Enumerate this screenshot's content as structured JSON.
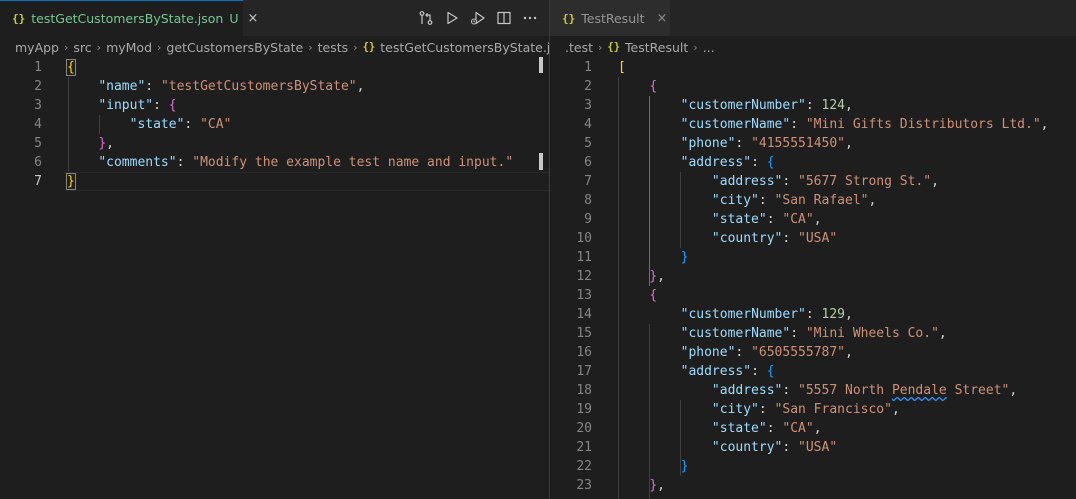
{
  "left": {
    "tab": {
      "icon": "{}",
      "label": "testGetCustomersByState.json",
      "badge": "U",
      "close": "×"
    },
    "actions": [
      {
        "name": "open-changes-icon",
        "title": "Open Changes"
      },
      {
        "name": "run-icon",
        "title": "Run"
      },
      {
        "name": "run-history-icon",
        "title": "Run All"
      },
      {
        "name": "split-editor-icon",
        "title": "Split Editor"
      },
      {
        "name": "more-actions-icon",
        "title": "More Actions"
      }
    ],
    "breadcrumb": [
      "myApp",
      "src",
      "myMod",
      "getCustomersByState",
      "tests",
      "testGetCustomersByState.json"
    ],
    "breadcrumb_file_icon": "{}",
    "active_line": 7,
    "lines": [
      {
        "n": "1",
        "t": [
          [
            "b1",
            "{"
          ]
        ]
      },
      {
        "n": "2",
        "t": [
          [
            "p",
            "    "
          ],
          [
            "k",
            "\"name\""
          ],
          [
            "p",
            ": "
          ],
          [
            "s",
            "\"testGetCustomersByState\""
          ],
          [
            "p",
            ","
          ]
        ]
      },
      {
        "n": "3",
        "t": [
          [
            "p",
            "    "
          ],
          [
            "k",
            "\"input\""
          ],
          [
            "p",
            ": "
          ],
          [
            "b2",
            "{"
          ]
        ]
      },
      {
        "n": "4",
        "t": [
          [
            "p",
            "        "
          ],
          [
            "k",
            "\"state\""
          ],
          [
            "p",
            ": "
          ],
          [
            "s",
            "\"CA\""
          ]
        ]
      },
      {
        "n": "5",
        "t": [
          [
            "p",
            "    "
          ],
          [
            "b2",
            "}"
          ],
          [
            "p",
            ","
          ]
        ]
      },
      {
        "n": "6",
        "t": [
          [
            "p",
            "    "
          ],
          [
            "k",
            "\"comments\""
          ],
          [
            "p",
            ": "
          ],
          [
            "s",
            "\"Modify the example test name and input.\""
          ]
        ]
      },
      {
        "n": "7",
        "t": [
          [
            "b1",
            "}"
          ]
        ]
      }
    ]
  },
  "right": {
    "tab": {
      "icon": "{}",
      "label": "TestResult",
      "close": "×"
    },
    "breadcrumb": [
      ".test",
      "TestResult",
      "..."
    ],
    "breadcrumb_file_icon": "{}",
    "lines": [
      {
        "n": "1",
        "t": [
          [
            "b1",
            "["
          ]
        ]
      },
      {
        "n": "2",
        "t": [
          [
            "p",
            "    "
          ],
          [
            "b2",
            "{"
          ]
        ]
      },
      {
        "n": "3",
        "t": [
          [
            "p",
            "        "
          ],
          [
            "k",
            "\"customerNumber\""
          ],
          [
            "p",
            ": "
          ],
          [
            "n",
            "124"
          ],
          [
            "p",
            ","
          ]
        ]
      },
      {
        "n": "4",
        "t": [
          [
            "p",
            "        "
          ],
          [
            "k",
            "\"customerName\""
          ],
          [
            "p",
            ": "
          ],
          [
            "s",
            "\"Mini Gifts Distributors Ltd.\""
          ],
          [
            "p",
            ","
          ]
        ]
      },
      {
        "n": "5",
        "t": [
          [
            "p",
            "        "
          ],
          [
            "k",
            "\"phone\""
          ],
          [
            "p",
            ": "
          ],
          [
            "s",
            "\"4155551450\""
          ],
          [
            "p",
            ","
          ]
        ]
      },
      {
        "n": "6",
        "t": [
          [
            "p",
            "        "
          ],
          [
            "k",
            "\"address\""
          ],
          [
            "p",
            ": "
          ],
          [
            "b3",
            "{"
          ]
        ]
      },
      {
        "n": "7",
        "t": [
          [
            "p",
            "            "
          ],
          [
            "k",
            "\"address\""
          ],
          [
            "p",
            ": "
          ],
          [
            "s",
            "\"5677 Strong St.\""
          ],
          [
            "p",
            ","
          ]
        ]
      },
      {
        "n": "8",
        "t": [
          [
            "p",
            "            "
          ],
          [
            "k",
            "\"city\""
          ],
          [
            "p",
            ": "
          ],
          [
            "s",
            "\"San Rafael\""
          ],
          [
            "p",
            ","
          ]
        ]
      },
      {
        "n": "9",
        "t": [
          [
            "p",
            "            "
          ],
          [
            "k",
            "\"state\""
          ],
          [
            "p",
            ": "
          ],
          [
            "s",
            "\"CA\""
          ],
          [
            "p",
            ","
          ]
        ]
      },
      {
        "n": "10",
        "t": [
          [
            "p",
            "            "
          ],
          [
            "k",
            "\"country\""
          ],
          [
            "p",
            ": "
          ],
          [
            "s",
            "\"USA\""
          ]
        ]
      },
      {
        "n": "11",
        "t": [
          [
            "p",
            "        "
          ],
          [
            "b3",
            "}"
          ]
        ]
      },
      {
        "n": "12",
        "t": [
          [
            "p",
            "    "
          ],
          [
            "b2",
            "}"
          ],
          [
            "p",
            ","
          ]
        ]
      },
      {
        "n": "13",
        "t": [
          [
            "p",
            "    "
          ],
          [
            "b2",
            "{"
          ]
        ]
      },
      {
        "n": "14",
        "t": [
          [
            "p",
            "        "
          ],
          [
            "k",
            "\"customerNumber\""
          ],
          [
            "p",
            ": "
          ],
          [
            "n",
            "129"
          ],
          [
            "p",
            ","
          ]
        ]
      },
      {
        "n": "15",
        "t": [
          [
            "p",
            "        "
          ],
          [
            "k",
            "\"customerName\""
          ],
          [
            "p",
            ": "
          ],
          [
            "s",
            "\"Mini Wheels Co.\""
          ],
          [
            "p",
            ","
          ]
        ]
      },
      {
        "n": "16",
        "t": [
          [
            "p",
            "        "
          ],
          [
            "k",
            "\"phone\""
          ],
          [
            "p",
            ": "
          ],
          [
            "s",
            "\"6505555787\""
          ],
          [
            "p",
            ","
          ]
        ]
      },
      {
        "n": "17",
        "t": [
          [
            "p",
            "        "
          ],
          [
            "k",
            "\"address\""
          ],
          [
            "p",
            ": "
          ],
          [
            "b3",
            "{"
          ]
        ]
      },
      {
        "n": "18",
        "t": [
          [
            "p",
            "            "
          ],
          [
            "k",
            "\"address\""
          ],
          [
            "p",
            ": "
          ],
          [
            "s",
            "\"5557 North "
          ],
          [
            "sq",
            "Pendale"
          ],
          [
            "s",
            " Street\""
          ],
          [
            "p",
            ","
          ]
        ]
      },
      {
        "n": "19",
        "t": [
          [
            "p",
            "            "
          ],
          [
            "k",
            "\"city\""
          ],
          [
            "p",
            ": "
          ],
          [
            "s",
            "\"San Francisco\""
          ],
          [
            "p",
            ","
          ]
        ]
      },
      {
        "n": "20",
        "t": [
          [
            "p",
            "            "
          ],
          [
            "k",
            "\"state\""
          ],
          [
            "p",
            ": "
          ],
          [
            "s",
            "\"CA\""
          ],
          [
            "p",
            ","
          ]
        ]
      },
      {
        "n": "21",
        "t": [
          [
            "p",
            "            "
          ],
          [
            "k",
            "\"country\""
          ],
          [
            "p",
            ": "
          ],
          [
            "s",
            "\"USA\""
          ]
        ]
      },
      {
        "n": "22",
        "t": [
          [
            "p",
            "        "
          ],
          [
            "b3",
            "}"
          ]
        ]
      },
      {
        "n": "23",
        "t": [
          [
            "p",
            "    "
          ],
          [
            "b2",
            "}"
          ],
          [
            "p",
            ","
          ]
        ]
      }
    ]
  },
  "colors": {
    "background": "#1e1e1e",
    "tab_bar": "#252526",
    "untracked_file": "#73c991",
    "json_key": "#9cdcfe",
    "json_string": "#ce9178",
    "json_number": "#b5cea8",
    "bracket_level1": "#ffd700",
    "bracket_level2": "#da70d6",
    "bracket_level3": "#179fff"
  }
}
